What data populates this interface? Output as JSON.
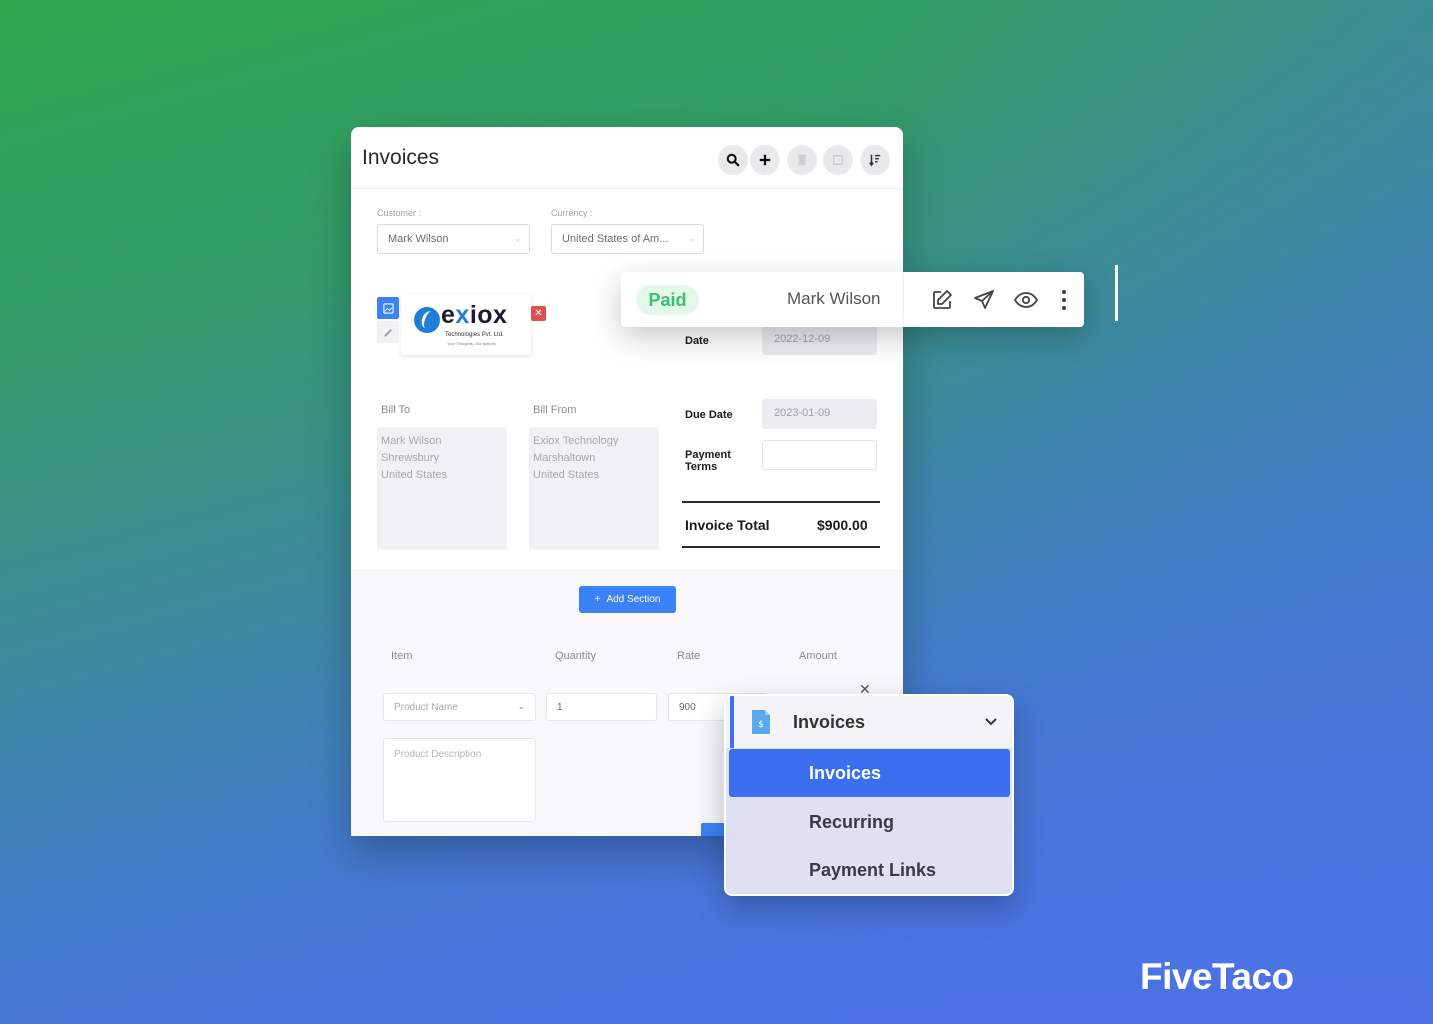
{
  "app": {
    "title": "Invoices",
    "toolbar": [
      {
        "name": "search",
        "icon": "search-icon"
      },
      {
        "name": "add",
        "icon": "plus-icon"
      },
      {
        "name": "delete",
        "icon": "trash-icon",
        "disabled": true
      },
      {
        "name": "select",
        "icon": "checkbox-icon",
        "disabled": true
      },
      {
        "name": "sort",
        "icon": "sort-icon"
      }
    ]
  },
  "form": {
    "customer_label": "Customer :",
    "customer_value": "Mark Wilson",
    "currency_label": "Currency :",
    "currency_value": "United States of Am...",
    "logo": {
      "company": "exiox",
      "subtitle": "Technologies Pvt. Ltd.",
      "tagline": "Your Thoughts, Our Actions"
    },
    "bill_to": {
      "label": "Bill To",
      "lines": [
        "Mark Wilson",
        "Shrewsbury",
        "United States"
      ]
    },
    "bill_from": {
      "label": "Bill From",
      "lines": [
        "Exiox Technology",
        "Marshaltown",
        "United States"
      ]
    },
    "date_label": "Date",
    "date_value": "2022-12-09",
    "due_date_label": "Due Date",
    "due_date_value": "2023-01-09",
    "payment_terms_label_1": "Payment",
    "payment_terms_label_2": "Terms",
    "payment_terms_value": "",
    "invoice_total_label": "Invoice Total",
    "invoice_total_value": "$900.00",
    "add_section_label": "Add Section",
    "columns": [
      "Item",
      "Quantity",
      "Rate",
      "Amount"
    ],
    "line_item": {
      "product_name_placeholder": "Product Name",
      "quantity": "1",
      "rate": "900",
      "description_placeholder": "Product Description"
    }
  },
  "invoice_row": {
    "status": "Paid",
    "customer": "Mark Wilson",
    "actions": [
      "edit-icon",
      "send-icon",
      "view-icon",
      "more-icon"
    ]
  },
  "menu": {
    "header": "Invoices",
    "items": [
      {
        "label": "Invoices",
        "active": true
      },
      {
        "label": "Recurring",
        "active": false
      },
      {
        "label": "Payment Links",
        "active": false
      }
    ]
  },
  "brand": "FiveTaco",
  "colors": {
    "accent": "#3b82f6",
    "menu_active": "#3b6ff0",
    "paid_text": "#3bbf72",
    "paid_bg": "#e3f7ea",
    "danger": "#e04f4f"
  }
}
